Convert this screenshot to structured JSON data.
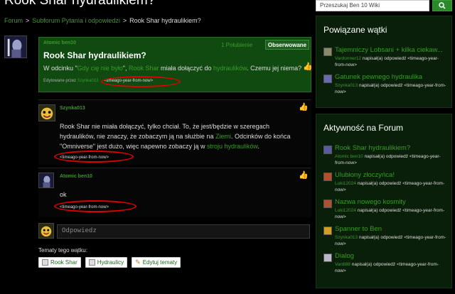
{
  "page": {
    "title": "Rook Shar hydraulikiem?",
    "breadcrumb": [
      "Forum",
      "Subforum Pytania i odpowiedzi",
      "Rook Shar hydraulikiem?"
    ]
  },
  "first_post": {
    "author": "Atomic ben10",
    "followers": "1 Połubienie",
    "follow_label": "Obserwowane",
    "title": "Rook Shar hydraulikiem?",
    "body_parts": [
      "W odcinku \"",
      "Gdy cię nie było",
      "\", ",
      "Rook Shar",
      " miała dołączyć do ",
      "hydraulików",
      ". Czemu jej niema?"
    ],
    "edited_label": "Edytowane przez",
    "edited_by": "Szynka013",
    "timestamp": "&lt;timeago-year-from-now&gt;"
  },
  "replies": [
    {
      "author": "Szynka013",
      "text_parts": [
        "Rook Shar nie miała dołączyć, tylko chciał. To, że jest/będzie w szeregach hydraulików, nie znaczy, że zobaczym ją na służbie na ",
        "Ziemi",
        ". Odcinków do końca \"Omniverse\" jest dużo, więc napewno zobaczy ją w ",
        "stroju hydraulików",
        "."
      ],
      "timestamp": "&lt;timeago-year-from-now&gt;"
    },
    {
      "author": "Atomic ben10",
      "text": "ok",
      "timestamp": "&lt;timeago-year-from-now&gt;"
    }
  ],
  "reply_box": {
    "placeholder": "Odpowiedz"
  },
  "tags": {
    "label": "Tematy tego wątku:",
    "items": [
      "Rook Shar",
      "Hydraulicy"
    ],
    "edit_label": "Edytuj tematy"
  },
  "search": {
    "placeholder": "Przeszukaj Ben 10 Wiki"
  },
  "related": {
    "heading": "Powiązane wątki",
    "items": [
      {
        "title": "Tajemniczy Lobsani + kilka ciekaw...",
        "user": "Vardonner12",
        "action": "napisał(a) odpowiedź",
        "time": "&lt;timeago-year-from-now&gt;"
      },
      {
        "title": "Gatunek pewnego hydraulika",
        "user": "Szynka013",
        "action": "napisał(a) odpowiedź",
        "time": "&lt;timeago-year-from-now&gt;"
      }
    ]
  },
  "activity": {
    "heading": "Aktywność na Forum",
    "items": [
      {
        "title": "Rook Shar hydraulikiem?",
        "user": "Atomic ben10",
        "action": "napisał(a) odpowiedź",
        "time": "&lt;timeago-year-from-now&gt;"
      },
      {
        "title": "Ulubiony złoczyńca!",
        "user": "Luki12024",
        "action": "napisał(a) odpowiedź",
        "time": "&lt;timeago-year-from-now&gt;"
      },
      {
        "title": "Nazwa nowego kosmity",
        "user": "Luki12024",
        "action": "napisał(a) odpowiedź",
        "time": "&lt;timeago-year-from-now&gt;"
      },
      {
        "title": "Spanner to Ben",
        "user": "Szynka013",
        "action": "napisał(a) odpowiedź",
        "time": "&lt;timeago-year-from-now&gt;"
      },
      {
        "title": "Dialog",
        "user": "Vardi88",
        "action": "napisał(a) odpowiedź",
        "time": "&lt;timeago-year-from-now&gt;"
      }
    ]
  },
  "colors": {
    "accent": "#3a9a2a",
    "panel": "#104a10",
    "annotation": "#e00000"
  }
}
